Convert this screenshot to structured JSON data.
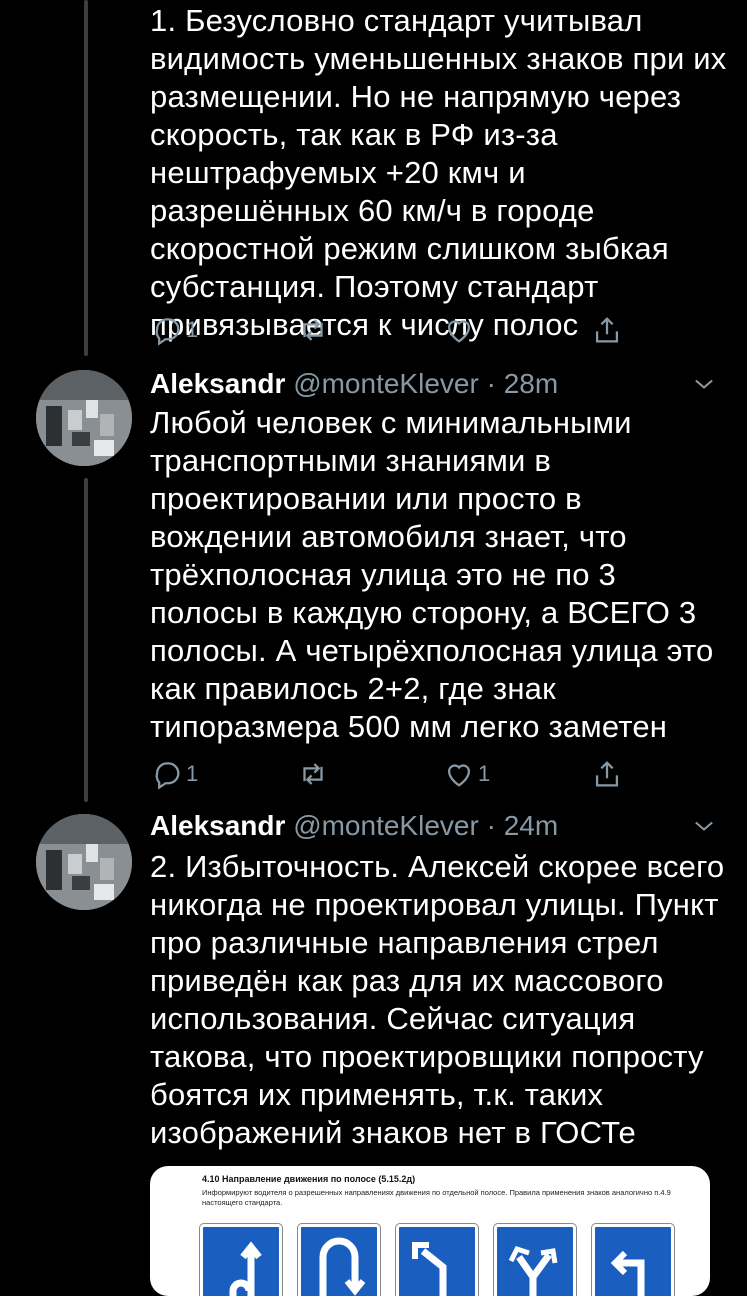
{
  "tweets": [
    {
      "text": "1. Безусловно стандарт учитывал видимость уменьшенных знаков при их размещении. Но не напрямую через скорость, так как в РФ из-за нештрафуемых +20 кмч и разрешённых 60 км/ч в городе скоростной режим слишком зыбкая субстанция. Поэтому стандарт привязывается к числу полос",
      "replies": "1",
      "retweets": "",
      "likes": ""
    },
    {
      "name": "Aleksandr",
      "handle": "@monteKlever",
      "time": "28m",
      "text": "Любой человек с минимальными транспортными знаниями в проектировании или просто в вождении автомобиля знает, что трёхполосная улица это не по 3 полосы в каждую сторону, а ВСЕГО 3 полосы. А четырёхполосная улица это как правилось 2+2, где знак типоразмера 500 мм легко заметен",
      "replies": "1",
      "retweets": "",
      "likes": "1"
    },
    {
      "name": "Aleksandr",
      "handle": "@monteKlever",
      "time": "24m",
      "text": "2. Избыточность. Алексей скорее всего никогда не проектировал улицы. Пункт про различные направления стрел приведён как раз для их массового использования. Сейчас ситуация такова, что проектировщики попросту боятся их применять, т.к. таких изображений знаков нет в ГОСТе",
      "media": {
        "caption_title": "4.10 Направление движения по полосе (5.15.2д)",
        "caption_body": "Информируют водителя о разрешенных направлениях движения по отдельной полосе. Правила применения знаков аналогично п.4.9 настоящего стандарта."
      }
    }
  ],
  "separator": "·",
  "colors": {
    "background": "#000000",
    "muted": "#8899a6",
    "thread": "#3b3f44",
    "sign_blue": "#1a5ec0"
  },
  "icons": [
    "reply-icon",
    "retweet-icon",
    "like-icon",
    "share-icon",
    "chevron-down-icon"
  ]
}
